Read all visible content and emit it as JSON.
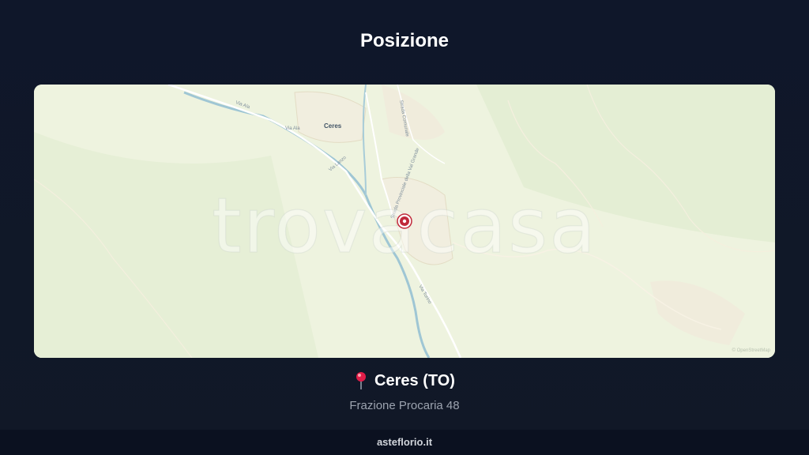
{
  "header": {
    "title": "Posizione"
  },
  "map": {
    "town_label": "Ceres",
    "road_labels": [
      "Via Ala",
      "Via Ala",
      "Via Lanzo",
      "Strada Provinciale della Val Grande",
      "Via Torino",
      "Strada Comunale"
    ],
    "watermark": "trovacasa",
    "attribution": "© OpenStreetMap",
    "marker_icon": "map-marker-icon",
    "colors": {
      "land": "#eef3df",
      "river": "#9fc6d4",
      "marker": "#c0283a"
    }
  },
  "location": {
    "pin_icon": "pushpin-icon",
    "place": "Ceres (TO)",
    "address": "Frazione Procaria 48"
  },
  "footer": {
    "site": "asteflorio.it"
  }
}
